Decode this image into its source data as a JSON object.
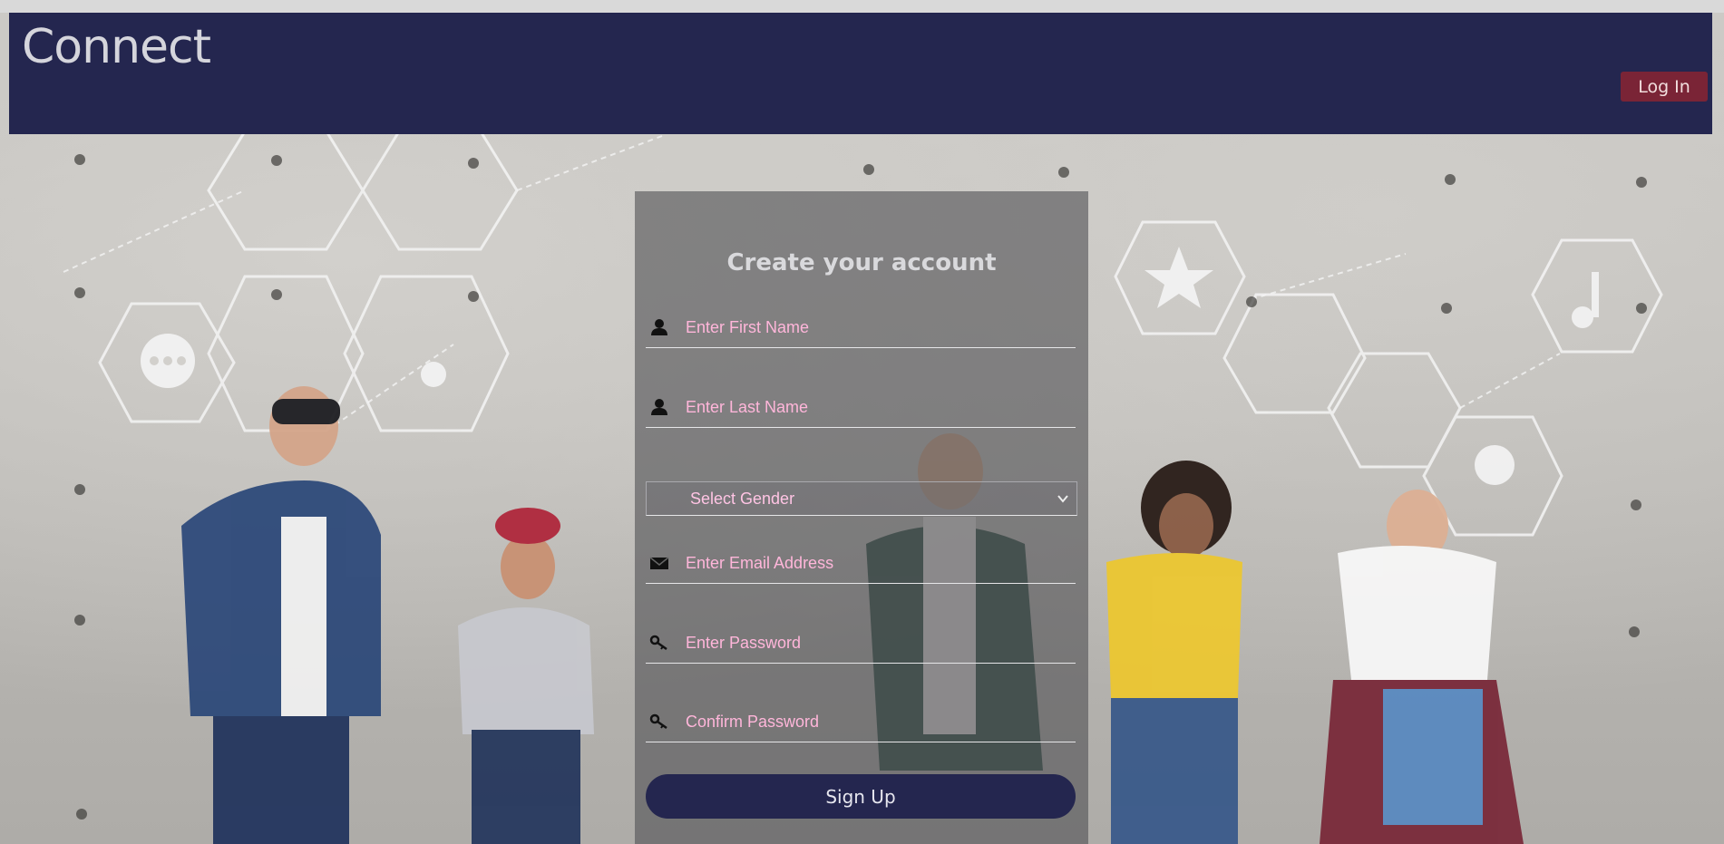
{
  "header": {
    "brand": "Connect",
    "login_label": "Log In"
  },
  "form": {
    "title": "Create your account",
    "first_name_placeholder": "Enter First Name",
    "last_name_placeholder": "Enter Last Name",
    "gender_selected": "Select Gender",
    "email_placeholder": "Enter Email Address",
    "password_placeholder": "Enter Password",
    "confirm_password_placeholder": "Confirm Password",
    "signup_label": "Sign Up"
  },
  "colors": {
    "header_bg": "#24264f",
    "login_bg": "#7a2436",
    "placeholder_text": "#ffb6da",
    "signup_bg": "#24264f"
  },
  "icons": {
    "first_name": "user-icon",
    "last_name": "user-icon",
    "gender": "chevron-down-icon",
    "email": "envelope-icon",
    "password": "key-icon",
    "confirm_password": "key-icon"
  }
}
